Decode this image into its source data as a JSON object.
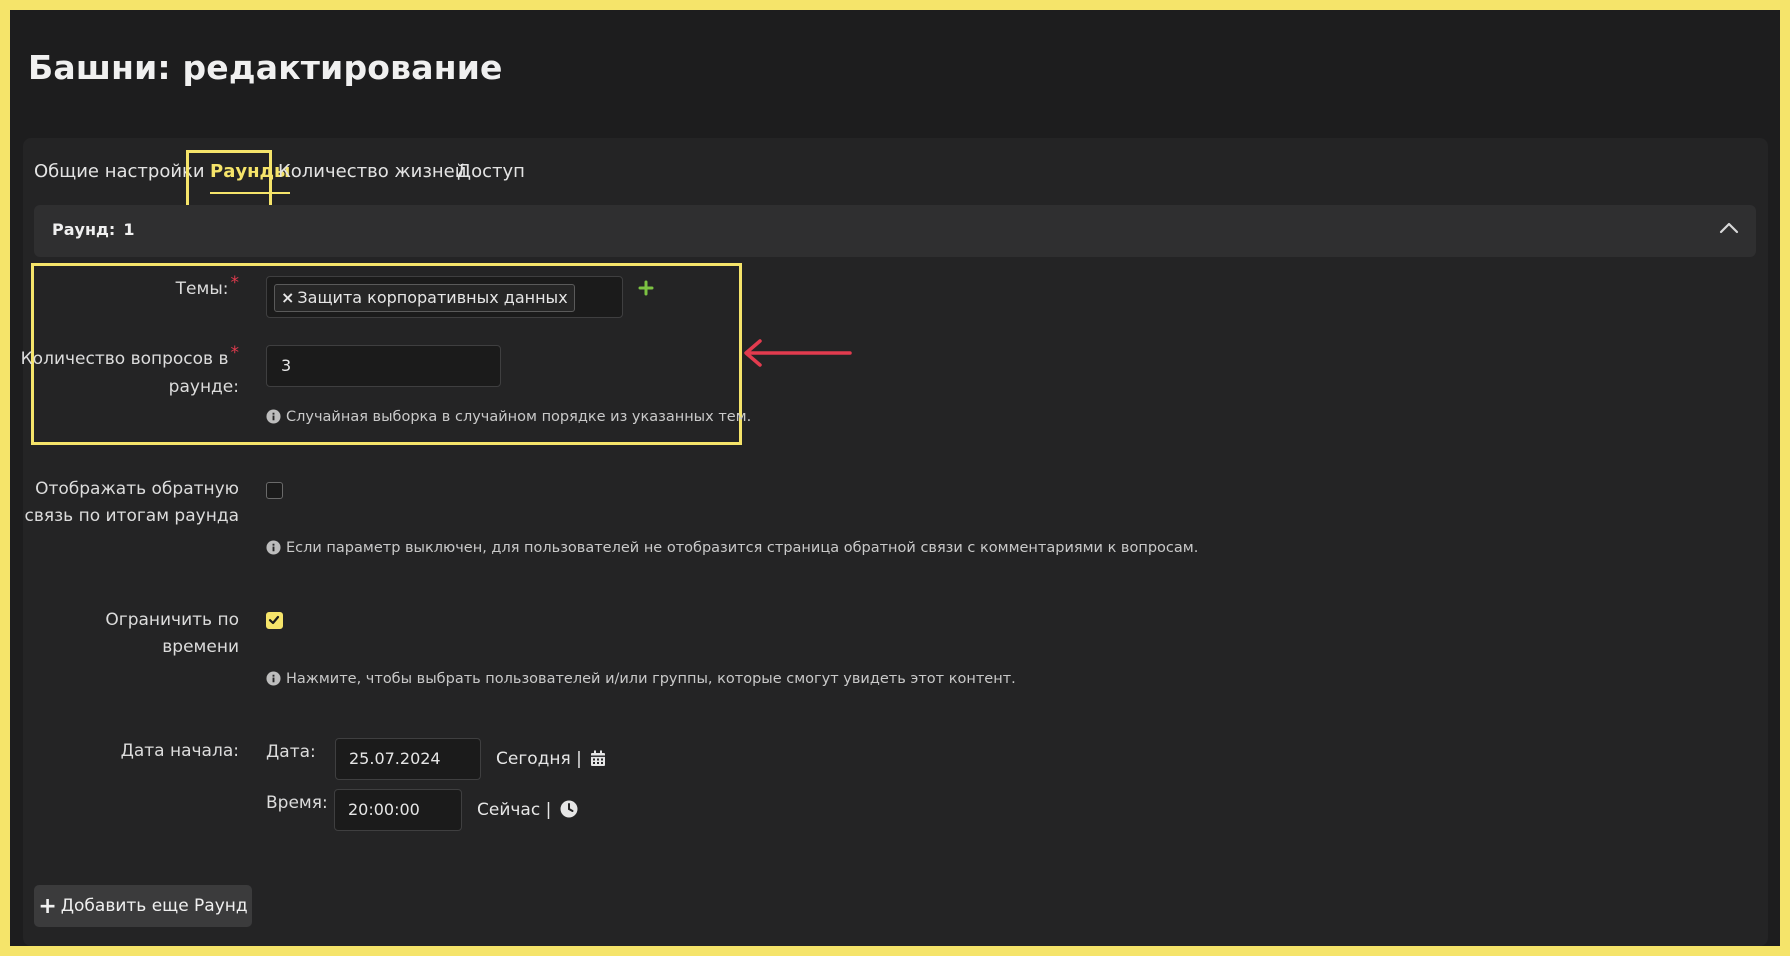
{
  "page": {
    "title": "Башни: редактирование"
  },
  "tabs": [
    {
      "label": "Общие настройки"
    },
    {
      "label": "Раунды"
    },
    {
      "label": "Количество жизней"
    },
    {
      "label": "Доступ"
    }
  ],
  "round": {
    "label": "Раунд:",
    "number": "1"
  },
  "fields": {
    "topics": {
      "label": "Темы:",
      "required_mark": "*",
      "tag": "Защита корпоративных данных",
      "tag_remove": "×"
    },
    "questions": {
      "label_line1": "Количество вопросов в",
      "label_line2": "раунде:",
      "required_mark": "*",
      "value": "3",
      "hint": "Случайная выборка в случайном порядке из указанных тем."
    },
    "feedback": {
      "label_line1": "Отображать обратную",
      "label_line2": "связь по итогам раунда",
      "checked": false,
      "hint": "Если параметр выключен, для пользователей не отобразится страница обратной связи с комментариями к вопросам."
    },
    "time_limit": {
      "label_line1": "Ограничить по",
      "label_line2": "времени",
      "checked": true,
      "hint": "Нажмите, чтобы выбрать пользователей и/или группы, которые смогут увидеть этот контент."
    },
    "start_date": {
      "label": "Дата начала:",
      "date_label": "Дата:",
      "date_value": "25.07.2024",
      "today_link": "Сегодня |",
      "time_label": "Время:",
      "time_value": "20:00:00",
      "now_link": "Сейчас |"
    }
  },
  "add_round_button": "Добавить еще Раунд",
  "colors": {
    "accent": "#f5e46a",
    "required": "#e23b4e",
    "add_topic": "#7cc242",
    "arrow": "#e23b4e"
  },
  "icons": [
    "chevron-up-icon",
    "plus-icon",
    "info-icon",
    "calendar-icon",
    "clock-icon",
    "check-icon",
    "arrow-left-icon"
  ]
}
